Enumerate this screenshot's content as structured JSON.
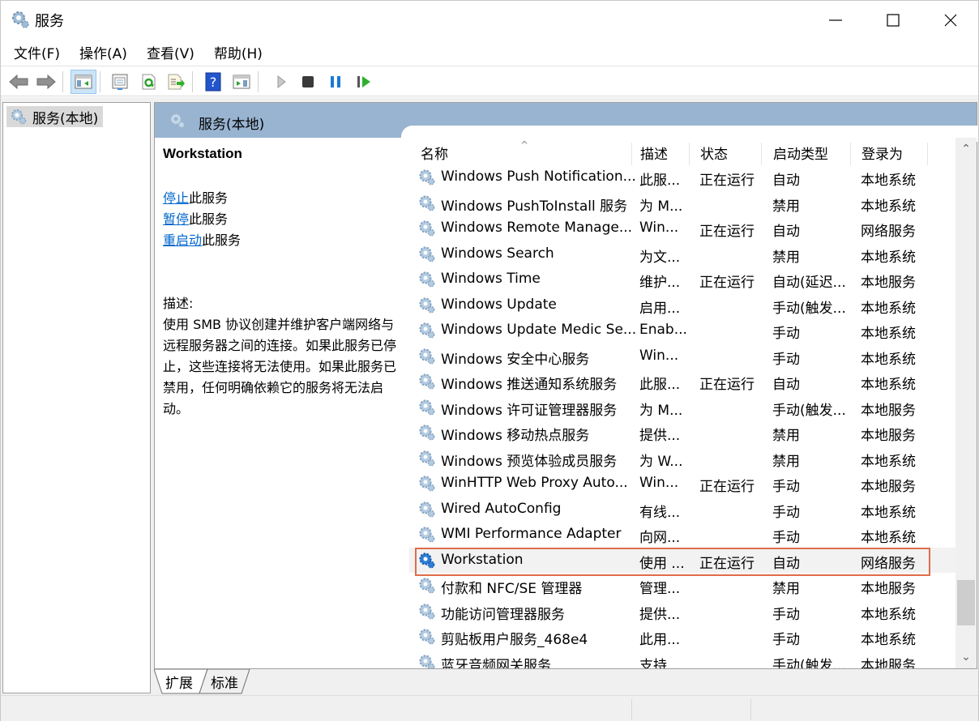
{
  "window": {
    "title": "服务",
    "controls": {
      "minimize": "minimize",
      "maximize": "maximize",
      "close": "close"
    }
  },
  "menu": [
    "文件(F)",
    "操作(A)",
    "查看(V)",
    "帮助(H)"
  ],
  "toolbar": {
    "buttons": [
      "back",
      "forward",
      "show-hide-console-tree",
      "properties",
      "refresh",
      "export-list",
      "help",
      "show-hide-action-pane",
      "start-service",
      "stop-service",
      "pause-service",
      "restart-service"
    ]
  },
  "tree": {
    "root_label": "服务(本地)"
  },
  "main": {
    "header_title": "服务(本地)",
    "detail": {
      "service_name": "Workstation",
      "actions": [
        {
          "link": "停止",
          "suffix": "此服务"
        },
        {
          "link": "暂停",
          "suffix": "此服务"
        },
        {
          "link": "重启动",
          "suffix": "此服务"
        }
      ],
      "desc_label": "描述:",
      "desc_text": "使用 SMB 协议创建并维护客户端网络与远程服务器之间的连接。如果此服务已停止，这些连接将无法使用。如果此服务已禁用，任何明确依赖它的服务将无法启动。"
    },
    "columns": [
      "名称",
      "描述",
      "状态",
      "启动类型",
      "登录为"
    ],
    "sort_indicator": "^",
    "rows": [
      {
        "name": "Windows Push Notification...",
        "desc": "此服...",
        "status": "正在运行",
        "startup": "自动",
        "logon": "本地系统"
      },
      {
        "name": "Windows PushToInstall 服务",
        "desc": "为 M...",
        "status": "",
        "startup": "禁用",
        "logon": "本地系统"
      },
      {
        "name": "Windows Remote Manage...",
        "desc": "Win...",
        "status": "正在运行",
        "startup": "自动",
        "logon": "网络服务"
      },
      {
        "name": "Windows Search",
        "desc": "为文...",
        "status": "",
        "startup": "禁用",
        "logon": "本地系统"
      },
      {
        "name": "Windows Time",
        "desc": "维护...",
        "status": "正在运行",
        "startup": "自动(延迟...",
        "logon": "本地服务"
      },
      {
        "name": "Windows Update",
        "desc": "启用...",
        "status": "",
        "startup": "手动(触发...",
        "logon": "本地系统"
      },
      {
        "name": "Windows Update Medic Se...",
        "desc": "Enab...",
        "status": "",
        "startup": "手动",
        "logon": "本地系统"
      },
      {
        "name": "Windows 安全中心服务",
        "desc": "Win...",
        "status": "",
        "startup": "手动",
        "logon": "本地系统"
      },
      {
        "name": "Windows 推送通知系统服务",
        "desc": "此服...",
        "status": "正在运行",
        "startup": "自动",
        "logon": "本地系统"
      },
      {
        "name": "Windows 许可证管理器服务",
        "desc": "为 M...",
        "status": "",
        "startup": "手动(触发...",
        "logon": "本地服务"
      },
      {
        "name": "Windows 移动热点服务",
        "desc": "提供...",
        "status": "",
        "startup": "禁用",
        "logon": "本地服务"
      },
      {
        "name": "Windows 预览体验成员服务",
        "desc": "为 W...",
        "status": "",
        "startup": "禁用",
        "logon": "本地系统"
      },
      {
        "name": "WinHTTP Web Proxy Auto...",
        "desc": "Win...",
        "status": "正在运行",
        "startup": "手动",
        "logon": "本地服务"
      },
      {
        "name": "Wired AutoConfig",
        "desc": "有线...",
        "status": "",
        "startup": "手动",
        "logon": "本地系统"
      },
      {
        "name": "WMI Performance Adapter",
        "desc": "向网...",
        "status": "",
        "startup": "手动",
        "logon": "本地系统"
      },
      {
        "name": "Workstation",
        "desc": "使用 ...",
        "status": "正在运行",
        "startup": "自动",
        "logon": "网络服务",
        "selected": true
      },
      {
        "name": "付款和 NFC/SE 管理器",
        "desc": "管理...",
        "status": "",
        "startup": "禁用",
        "logon": "本地服务"
      },
      {
        "name": "功能访问管理器服务",
        "desc": "提供...",
        "status": "",
        "startup": "手动",
        "logon": "本地系统"
      },
      {
        "name": "剪贴板用户服务_468e4",
        "desc": "此用...",
        "status": "",
        "startup": "手动",
        "logon": "本地系统"
      },
      {
        "name": "蓝牙音频网关服务",
        "desc": "支持...",
        "status": "",
        "startup": "手动(触发...",
        "logon": "本地服务"
      }
    ],
    "scroll": {
      "position_fraction": 0.9
    }
  },
  "tabs": [
    "扩展",
    "标准"
  ],
  "colors": {
    "header_bg": "#99b4d1",
    "link": "#0066cc",
    "selection_border": "#e06c4a",
    "tree_selected": "#d9d9d9"
  }
}
